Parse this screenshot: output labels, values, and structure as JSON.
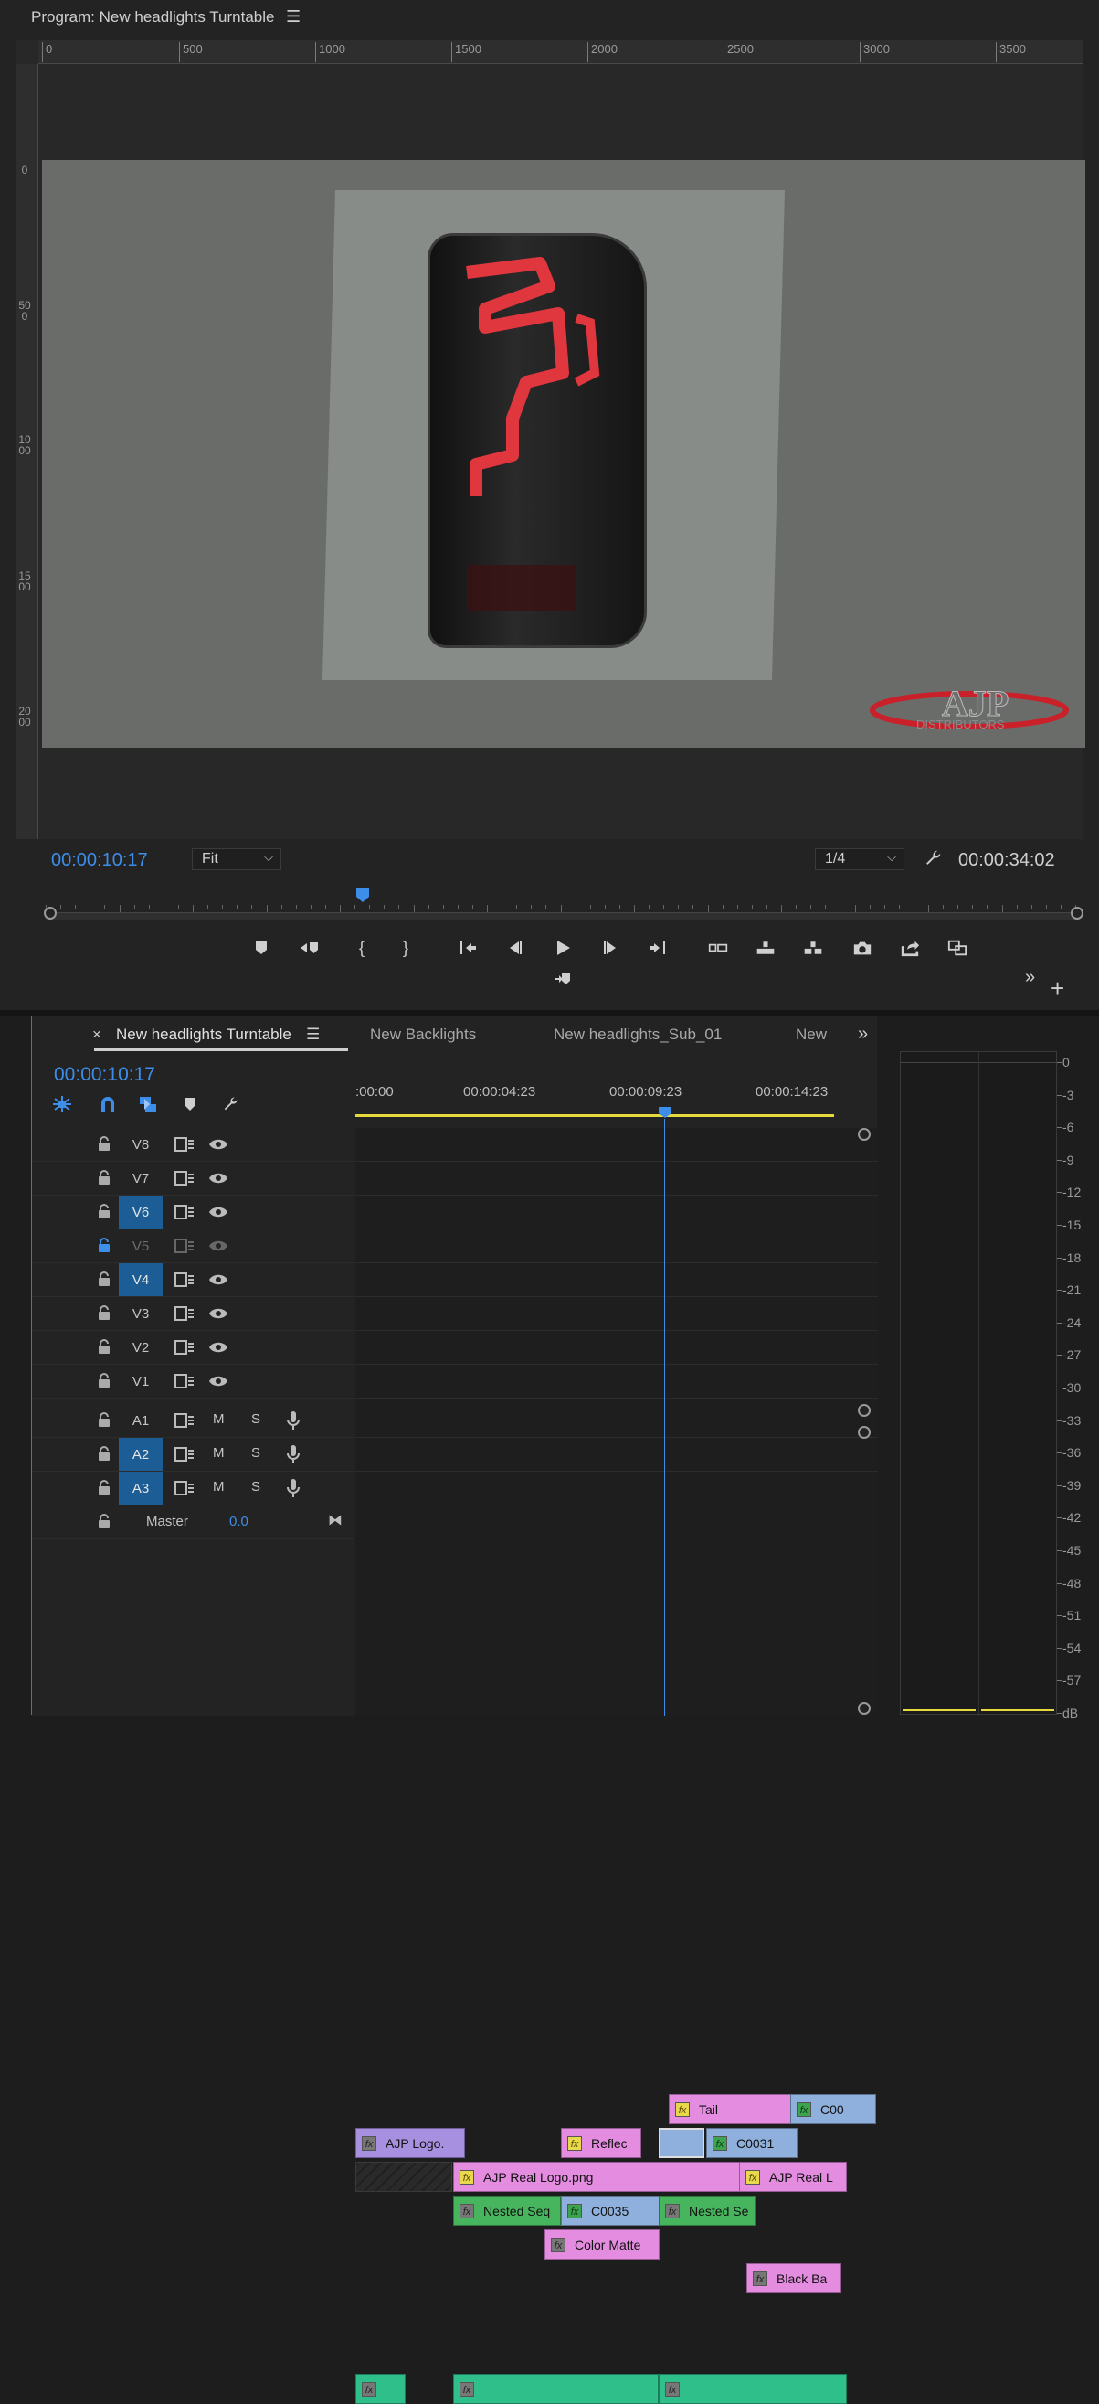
{
  "program_monitor": {
    "title": "Program: New headlights Turntable",
    "ruler_h": [
      "0",
      "500",
      "1000",
      "1500",
      "2000",
      "2500",
      "3000",
      "3500"
    ],
    "ruler_v": [
      "0",
      "500",
      "1000",
      "1500",
      "2000"
    ],
    "timecode": "00:00:10:17",
    "fit_label": "Fit",
    "resolution_label": "1/4",
    "duration": "00:00:34:02",
    "playhead_fraction": 0.307
  },
  "timeline": {
    "tabs": [
      {
        "label": "New headlights Turntable",
        "active": true
      },
      {
        "label": "New Backlights",
        "active": false
      },
      {
        "label": "New headlights_Sub_01",
        "active": false
      },
      {
        "label": "New",
        "active": false
      }
    ],
    "close_glyph": "×",
    "timecode": "00:00:10:17",
    "ruler_labels": [
      ":00:00",
      "00:00:04:23",
      "00:00:09:23",
      "00:00:14:23"
    ],
    "video_tracks": [
      {
        "name": "V8",
        "selected": false,
        "locked": false
      },
      {
        "name": "V7",
        "selected": false,
        "locked": false
      },
      {
        "name": "V6",
        "selected": true,
        "locked": false
      },
      {
        "name": "V5",
        "selected": false,
        "locked": true
      },
      {
        "name": "V4",
        "selected": true,
        "locked": false
      },
      {
        "name": "V3",
        "selected": false,
        "locked": false
      },
      {
        "name": "V2",
        "selected": false,
        "locked": false
      },
      {
        "name": "V1",
        "selected": false,
        "locked": false
      }
    ],
    "audio_tracks": [
      {
        "name": "A1",
        "selected": false
      },
      {
        "name": "A2",
        "selected": true
      },
      {
        "name": "A3",
        "selected": true
      }
    ],
    "mute_label": "M",
    "solo_label": "S",
    "master": {
      "label": "Master",
      "value": "0.0"
    },
    "clips": {
      "v7_tail": "Tail",
      "v7_c00": "C00",
      "v6_ajp_logo": "AJP Logo.",
      "v6_reflec": "Reflec",
      "v6_c0031": "C0031",
      "v5_ajp_real_logo": "AJP Real Logo.png",
      "v5_ajp_real_l": "AJP Real L",
      "v4_nested_seq": "Nested Seq",
      "v4_c0035": "C0035",
      "v4_nested_se": "Nested Se",
      "v3_color_matte": "Color Matte",
      "v2_black_ba": "Black Ba"
    },
    "fx_label": "fx"
  },
  "audio_meter": {
    "scale": [
      "0",
      "-3",
      "-6",
      "-9",
      "-12",
      "-15",
      "-18",
      "-21",
      "-24",
      "-27",
      "-30",
      "-33",
      "-36",
      "-39",
      "-42",
      "-45",
      "-48",
      "-51",
      "-54",
      "-57",
      "dB"
    ]
  },
  "colors": {
    "accent_blue": "#3d8ee8",
    "track_selected": "#1b5d94",
    "clip_pink": "#e48ce0",
    "clip_blue": "#8fb0dc",
    "clip_green": "#47b55e",
    "audio_clip": "#2fbf8a",
    "work_area": "#e6d93b"
  }
}
